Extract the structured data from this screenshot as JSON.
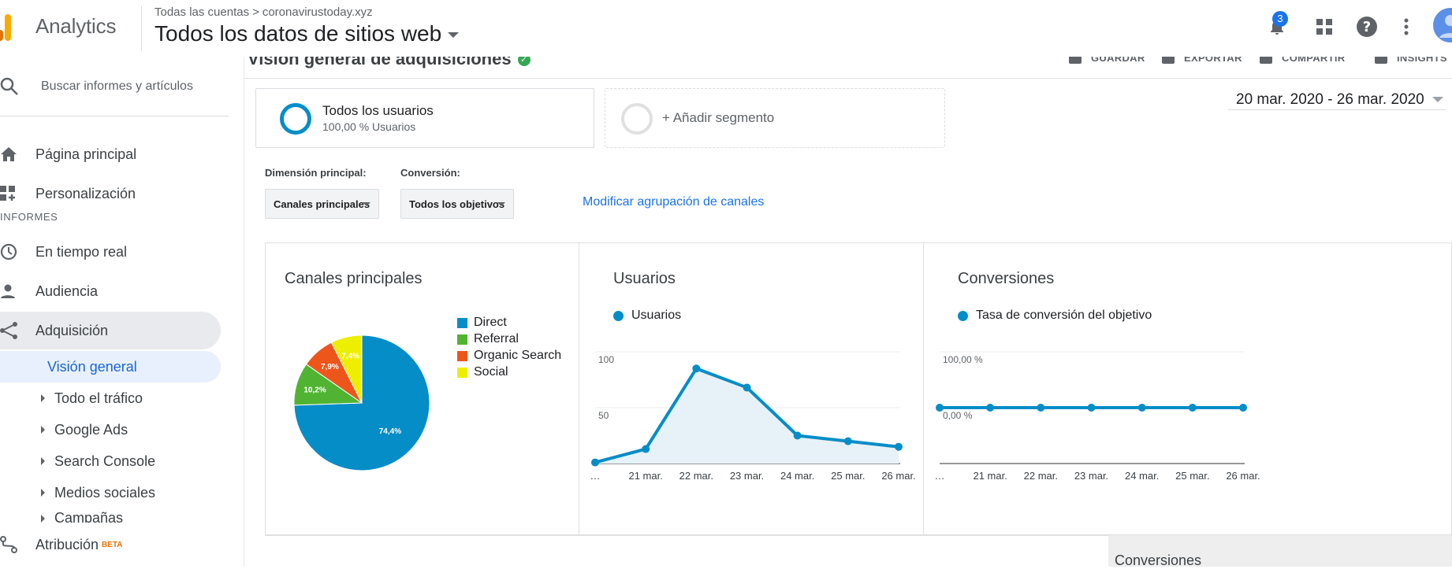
{
  "header": {
    "app_name": "Analytics",
    "breadcrumb": [
      "Todas las cuentas",
      "coronavirustoday.xyz"
    ],
    "breadcrumb_sep": ">",
    "property_name": "Todos los datos de sitios web",
    "notification_count": "3",
    "icons": [
      "bell-icon",
      "apps-grid-icon",
      "help-icon",
      "more-vert-icon",
      "account-avatar"
    ]
  },
  "sidebar": {
    "search_placeholder": "Buscar informes y artículos",
    "top_items": [
      {
        "label": "Página principal",
        "icon": "home-icon"
      },
      {
        "label": "Personalización",
        "icon": "customization-icon"
      }
    ],
    "section_label": "INFORMES",
    "report_items": [
      {
        "label": "En tiempo real",
        "icon": "clock-icon"
      },
      {
        "label": "Audiencia",
        "icon": "person-icon"
      },
      {
        "label": "Adquisición",
        "icon": "acquisition-icon"
      }
    ],
    "selected_subitem": "Visión general",
    "subitems": [
      "Todo el tráfico",
      "Google Ads",
      "Search Console",
      "Medios sociales",
      "Campañas"
    ],
    "bottom_item": {
      "label": "Atribución",
      "badge": "BETA",
      "icon": "attribution-icon"
    }
  },
  "toolbar": {
    "page_title": "Visión general de adquisiciones",
    "actions": [
      "GUARDAR",
      "EXPORTAR",
      "COMPARTIR",
      "INSIGHTS"
    ]
  },
  "segments": {
    "active": {
      "title": "Todos los usuarios",
      "subtitle": "100,00 % Usuarios"
    },
    "add_label": "+ Añadir segmento"
  },
  "date_range": "20 mar. 2020 - 26 mar. 2020",
  "controls": {
    "dimension_label": "Dimensión principal:",
    "dimension_value": "Canales principales",
    "conversion_label": "Conversión:",
    "conversion_value": "Todos los objetivos",
    "modify_link": "Modificar agrupación de canales"
  },
  "chart_data": [
    {
      "type": "pie",
      "title": "Canales principales",
      "categories": [
        "Direct",
        "Referral",
        "Organic Search",
        "Social"
      ],
      "values": [
        74.4,
        10.2,
        7.9,
        7.4
      ],
      "labels": [
        "74,4%",
        "10,2%",
        "7,9%",
        "7,4%"
      ],
      "colors": [
        "#058dc7",
        "#50b432",
        "#ed561b",
        "#edef00"
      ],
      "legend": "right"
    },
    {
      "type": "area",
      "title": "Usuarios",
      "series": [
        {
          "name": "Usuarios",
          "values": [
            1,
            13,
            85,
            68,
            25,
            20,
            15
          ]
        }
      ],
      "x": [
        "…",
        "21 mar.",
        "22 mar.",
        "23 mar.",
        "24 mar.",
        "25 mar.",
        "26 mar."
      ],
      "yticks": [
        "100",
        "50"
      ],
      "ylim": [
        0,
        100
      ],
      "color": "#058dc7"
    },
    {
      "type": "line",
      "title": "Conversiones",
      "series": [
        {
          "name": "Tasa de conversión del objetivo",
          "values": [
            0,
            0,
            0,
            0,
            0,
            0,
            0
          ]
        }
      ],
      "x": [
        "…",
        "21 mar.",
        "22 mar.",
        "23 mar.",
        "24 mar.",
        "25 mar.",
        "26 mar."
      ],
      "yticks": [
        "100,00 %",
        "0,00 %"
      ],
      "ylim": [
        -100,
        100
      ],
      "color": "#058dc7"
    }
  ],
  "bottom_panel_title": "Conversiones"
}
